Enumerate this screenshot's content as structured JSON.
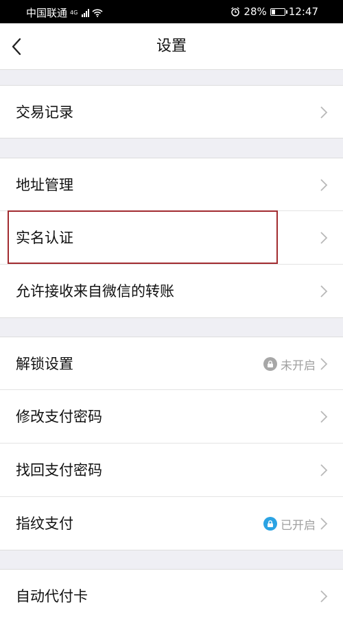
{
  "status_bar": {
    "carrier": "中国联通",
    "network": "4G",
    "battery_percent": "28%",
    "battery_level": 0.28,
    "time": "12:47"
  },
  "nav": {
    "title": "设置"
  },
  "colors": {
    "highlight_border": "#a12a2e",
    "lock_off": "#a7a7a7",
    "lock_on": "#2ba3e3"
  },
  "groups": [
    {
      "items": [
        {
          "label": "交易记录"
        }
      ]
    },
    {
      "items": [
        {
          "label": "地址管理"
        },
        {
          "label": "实名认证"
        },
        {
          "label": "允许接收来自微信的转账"
        }
      ]
    },
    {
      "items": [
        {
          "label": "解锁设置",
          "status": "未开启"
        },
        {
          "label": "修改支付密码"
        },
        {
          "label": "找回支付密码"
        },
        {
          "label": "指纹支付",
          "status": "已开启"
        }
      ]
    },
    {
      "items": [
        {
          "label": "自动代付卡"
        }
      ]
    }
  ]
}
